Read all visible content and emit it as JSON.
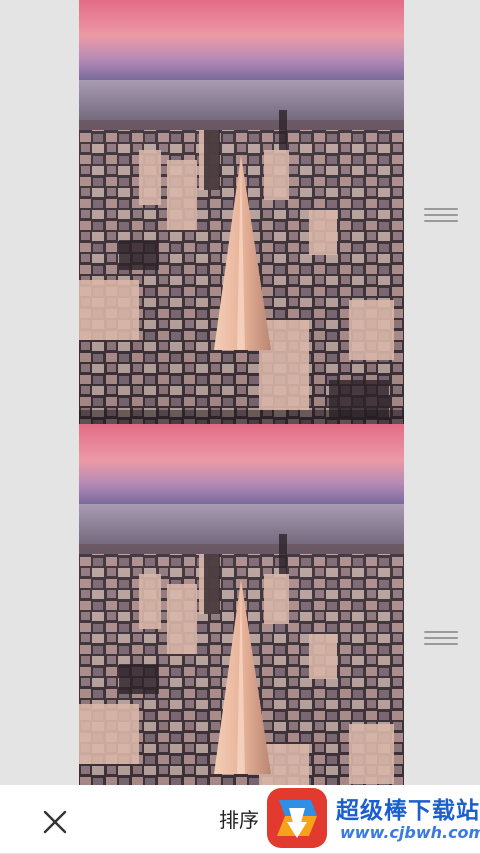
{
  "items": [
    {
      "image": "san-francisco-aerial-photo",
      "handle_icon": "drag-handle-icon"
    },
    {
      "image": "san-francisco-aerial-photo",
      "handle_icon": "drag-handle-icon"
    }
  ],
  "bottom_bar": {
    "close_icon": "close-icon",
    "sort_label": "排序"
  },
  "watermark": {
    "logo": "download-site-logo",
    "text": "超级棒下载站",
    "url": "www.cjbwh.com"
  },
  "colors": {
    "background": "#e4e4e4",
    "bar": "#ffffff",
    "watermark_blue": "#1a5fd0"
  }
}
